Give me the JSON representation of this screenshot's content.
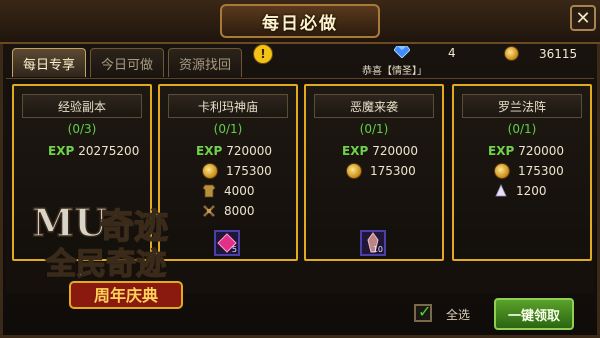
{
  "header": {
    "title": "每日必做",
    "close_label": "✕"
  },
  "tabs": [
    {
      "label": "每日专享",
      "active": true
    },
    {
      "label": "今日可做",
      "active": false
    },
    {
      "label": "资源找回",
      "active": false
    }
  ],
  "alert_badge": "!",
  "currency": {
    "gems": "4",
    "gold": "36115"
  },
  "congrats_text": "恭喜【情圣】」",
  "cards": [
    {
      "title": "经验副本",
      "progress": "(0/3)",
      "exp": "20275200",
      "rewards": [],
      "item_count": ""
    },
    {
      "title": "卡利玛神庙",
      "progress": "(0/1)",
      "exp": "720000",
      "rewards": [
        {
          "icon": "gold-coin-icon",
          "value": "175300"
        },
        {
          "icon": "armor-icon",
          "value": "4000"
        },
        {
          "icon": "scroll-icon",
          "value": "8000"
        }
      ],
      "item_count": "5"
    },
    {
      "title": "恶魔来袭",
      "progress": "(0/1)",
      "exp": "720000",
      "rewards": [
        {
          "icon": "gold-coin-icon",
          "value": "175300"
        }
      ],
      "item_count": "10"
    },
    {
      "title": "罗兰法阵",
      "progress": "(0/1)",
      "exp": "720000",
      "rewards": [
        {
          "icon": "gold-coin-icon",
          "value": "175300"
        },
        {
          "icon": "crystal-icon",
          "value": "1200"
        }
      ],
      "item_count": ""
    }
  ],
  "exp_label": "EXP",
  "logo": {
    "line1": "全民奇迹",
    "line2": "周年庆典"
  },
  "footer": {
    "select_all_label": "全选",
    "one_click_label": "一键领取"
  },
  "colors": {
    "card_border": "#e2aa1f",
    "progress_green": "#60d04a",
    "button_green": "#5aa12b"
  }
}
